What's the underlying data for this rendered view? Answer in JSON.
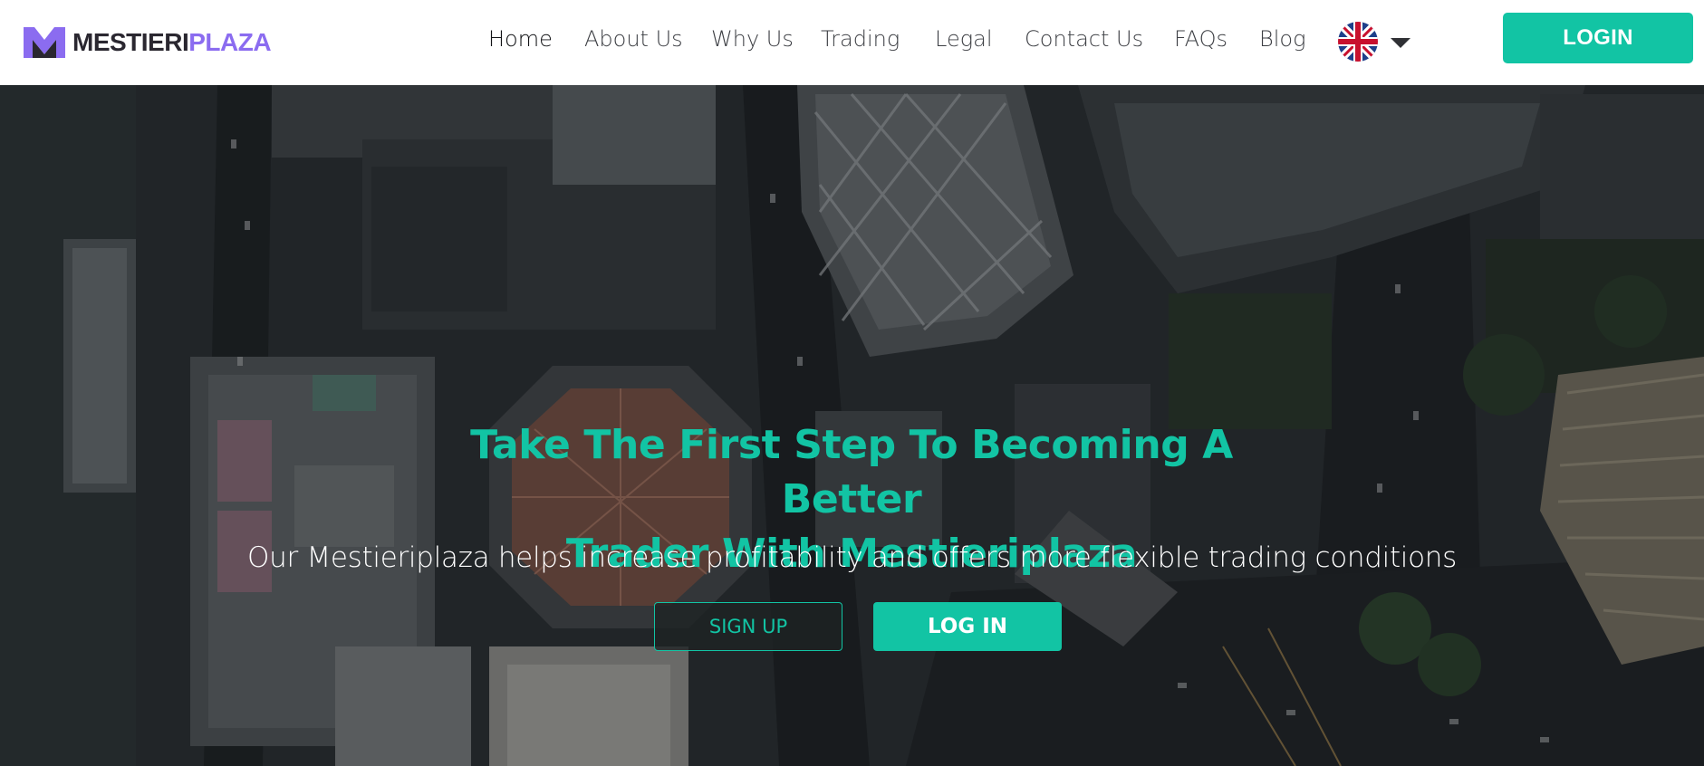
{
  "brand": {
    "name_part1": "MESTIERI",
    "name_part2": "PLAZA",
    "logo_icon": "m-logo-icon",
    "colors": {
      "dark": "#2a2730",
      "purple": "#8b6cf0"
    }
  },
  "nav": {
    "items": [
      {
        "label": "Home",
        "active": true
      },
      {
        "label": "About Us"
      },
      {
        "label": "Why Us"
      },
      {
        "label": "Trading"
      },
      {
        "label": "Legal"
      },
      {
        "label": "Contact Us"
      },
      {
        "label": "FAQs"
      },
      {
        "label": "Blog"
      }
    ],
    "language": {
      "icon": "uk-flag-icon",
      "dropdown_icon": "chevron-down-icon"
    }
  },
  "header": {
    "login_label": "LOGIN"
  },
  "hero": {
    "title_line1": "Take The First Step To Becoming A Better",
    "title_line2": "Trader With Mestieriplaza",
    "subtitle": "Our Mestieriplaza helps increase profitability and offers more flexible trading conditions",
    "signup_label": "SIGN UP",
    "login_label": "LOG IN",
    "background": "aerial-city-photo"
  },
  "colors": {
    "accent": "#12c4a4",
    "header_bg": "#ffffff",
    "nav_text": "#3d3f44"
  }
}
